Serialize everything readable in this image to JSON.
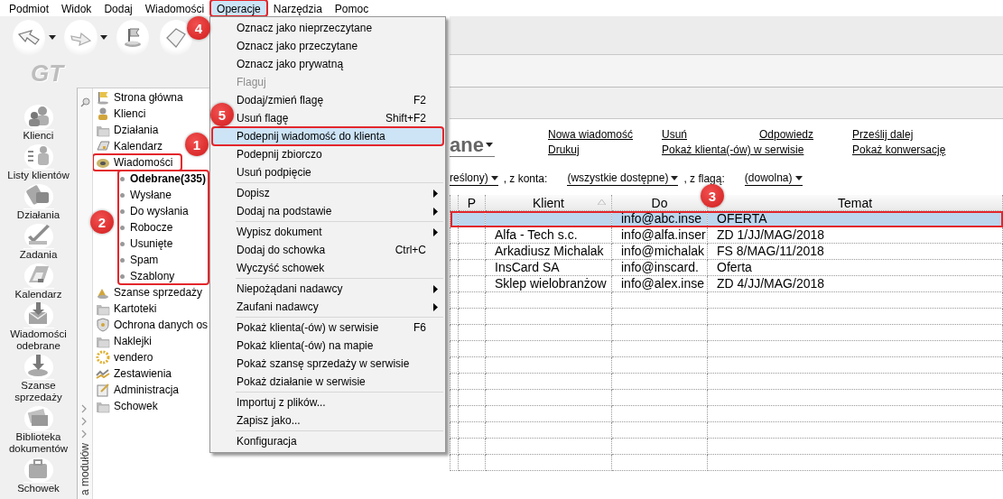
{
  "menubar": [
    {
      "label": "Podmiot",
      "open": false
    },
    {
      "label": "Widok",
      "open": false
    },
    {
      "label": "Dodaj",
      "open": false
    },
    {
      "label": "Wiadomości",
      "open": false
    },
    {
      "label": "Operacje",
      "open": true
    },
    {
      "label": "Narzędzia",
      "open": false
    },
    {
      "label": "Pomoc",
      "open": false
    }
  ],
  "logo": "GT",
  "modules": [
    {
      "label": "Klienci"
    },
    {
      "label": "Listy klientów"
    },
    {
      "label": "Działania"
    },
    {
      "label": "Zadania"
    },
    {
      "label": "Kalendarz"
    },
    {
      "label": "Wiadomości odebrane"
    },
    {
      "label": "Szanse sprzedaży"
    },
    {
      "label": "Biblioteka dokumentów"
    },
    {
      "label": "Schowek"
    }
  ],
  "module_panel_label": "a modułów",
  "tree": [
    {
      "label": "Strona główna",
      "highlighted": false
    },
    {
      "label": "Klienci",
      "highlighted": false
    },
    {
      "label": "Działania",
      "highlighted": false
    },
    {
      "label": "Kalendarz",
      "highlighted": false
    },
    {
      "label": "Wiadomości",
      "highlighted": true,
      "children_highlighted": true,
      "children": [
        {
          "label": "Odebrane(335)",
          "selected": true
        },
        {
          "label": "Wysłane",
          "selected": false
        },
        {
          "label": "Do wysłania",
          "selected": false
        },
        {
          "label": "Robocze",
          "selected": false
        },
        {
          "label": "Usunięte",
          "selected": false
        },
        {
          "label": "Spam",
          "selected": false
        },
        {
          "label": "Szablony",
          "selected": false
        }
      ]
    },
    {
      "label": "Szanse sprzedaży",
      "highlighted": false
    },
    {
      "label": "Kartoteki",
      "highlighted": false
    },
    {
      "label": "Ochrona danych os",
      "highlighted": false
    },
    {
      "label": "Naklejki",
      "highlighted": false
    },
    {
      "label": "vendero",
      "highlighted": false
    },
    {
      "label": "Zestawienia",
      "highlighted": false
    },
    {
      "label": "Administracja",
      "highlighted": false
    },
    {
      "label": "Schowek",
      "highlighted": false
    }
  ],
  "operations_menu": {
    "groups": [
      [
        {
          "label": "Oznacz jako nieprzeczytane",
          "disabled": false,
          "selected": false,
          "submenu": false
        },
        {
          "label": "Oznacz jako przeczytane",
          "disabled": false,
          "selected": false,
          "submenu": false
        },
        {
          "label": "Oznacz jako prywatną",
          "disabled": false,
          "selected": false,
          "submenu": false
        },
        {
          "label": "Flaguj",
          "disabled": true,
          "selected": false,
          "submenu": false
        },
        {
          "label": "Dodaj/zmień flagę",
          "shortcut": "F2",
          "disabled": false,
          "selected": false,
          "submenu": false
        },
        {
          "label": "Usuń flagę",
          "shortcut": "Shift+F2",
          "disabled": false,
          "selected": false,
          "submenu": false
        },
        {
          "label": "Podepnij wiadomość do klienta",
          "disabled": false,
          "selected": true,
          "submenu": false
        },
        {
          "label": "Podepnij zbiorczo",
          "disabled": false,
          "selected": false,
          "submenu": false
        },
        {
          "label": "Usuń podpięcie",
          "disabled": false,
          "selected": false,
          "submenu": false
        }
      ],
      [
        {
          "label": "Dopisz",
          "disabled": false,
          "selected": false,
          "submenu": true
        },
        {
          "label": "Dodaj na podstawie",
          "disabled": false,
          "selected": false,
          "submenu": true
        }
      ],
      [
        {
          "label": "Wypisz dokument",
          "disabled": false,
          "selected": false,
          "submenu": true
        },
        {
          "label": "Dodaj do schowka",
          "shortcut": "Ctrl+C",
          "disabled": false,
          "selected": false,
          "submenu": false
        },
        {
          "label": "Wyczyść schowek",
          "disabled": false,
          "selected": false,
          "submenu": false
        }
      ],
      [
        {
          "label": "Niepożądani nadawcy",
          "disabled": false,
          "selected": false,
          "submenu": true
        },
        {
          "label": "Zaufani nadawcy",
          "disabled": false,
          "selected": false,
          "submenu": true
        }
      ],
      [
        {
          "label": "Pokaż klienta(-ów) w serwisie",
          "shortcut": "F6",
          "disabled": false,
          "selected": false,
          "submenu": false
        },
        {
          "label": "Pokaż klienta(-ów) na mapie",
          "disabled": false,
          "selected": false,
          "submenu": false
        },
        {
          "label": "Pokaż szansę sprzedaży w serwisie",
          "disabled": false,
          "selected": false,
          "submenu": false
        },
        {
          "label": "Pokaż działanie w serwisie",
          "disabled": false,
          "selected": false,
          "submenu": false
        }
      ],
      [
        {
          "label": "Importuj z plików...",
          "disabled": false,
          "selected": false,
          "submenu": false
        },
        {
          "label": "Zapisz jako...",
          "disabled": false,
          "selected": false,
          "submenu": false
        }
      ],
      [
        {
          "label": "Konfiguracja",
          "disabled": false,
          "selected": false,
          "submenu": false
        }
      ]
    ]
  },
  "folder_title": "ane",
  "actions": [
    [
      "Nowa wiadomość",
      "Drukuj"
    ],
    [
      "Usuń",
      "Pokaż klienta(-ów) w serwisie"
    ],
    [
      "Odpowiedz"
    ],
    [
      "Prześlij dalej",
      "Pokaż konwersację"
    ]
  ],
  "filters": [
    {
      "kind": "dropdown",
      "text": "reślony)"
    },
    {
      "kind": "label",
      "text": ", z konta:"
    },
    {
      "kind": "dropdown",
      "text": "(wszystkie dostępne)"
    },
    {
      "kind": "label",
      "text": ", z flagą:"
    },
    {
      "kind": "dropdown",
      "text": "(dowolna)"
    }
  ],
  "table": {
    "columns": [
      {
        "label": "P",
        "sorted": false
      },
      {
        "label": "Klient",
        "sorted": true
      },
      {
        "label": "Do",
        "sorted": false
      },
      {
        "label": "Temat",
        "sorted": false
      }
    ],
    "rows": [
      {
        "do": "info@abc.inse",
        "temat": "OFERTA",
        "selected": true,
        "highlighted": true
      },
      {
        "klient": "Alfa - Tech s.c.",
        "do": "info@alfa.inser",
        "temat": "ZD 1/JJ/MAG/2018",
        "selected": false,
        "highlighted": false
      },
      {
        "klient": "Arkadiusz Michalak",
        "do": "info@michalak",
        "temat": "FS 8/MAG/11/2018",
        "selected": false,
        "highlighted": false
      },
      {
        "klient": "InsCard SA",
        "do": "info@inscard.",
        "temat": "Oferta",
        "selected": false,
        "highlighted": false
      },
      {
        "klient": "Sklep wielobranżow",
        "do": "info@alex.inse",
        "temat": "ZD 4/JJ/MAG/2018",
        "selected": false,
        "highlighted": false
      }
    ]
  },
  "annotations": [
    {
      "label": "1"
    },
    {
      "label": "2"
    },
    {
      "label": "3"
    },
    {
      "label": "4"
    },
    {
      "label": "5"
    }
  ]
}
